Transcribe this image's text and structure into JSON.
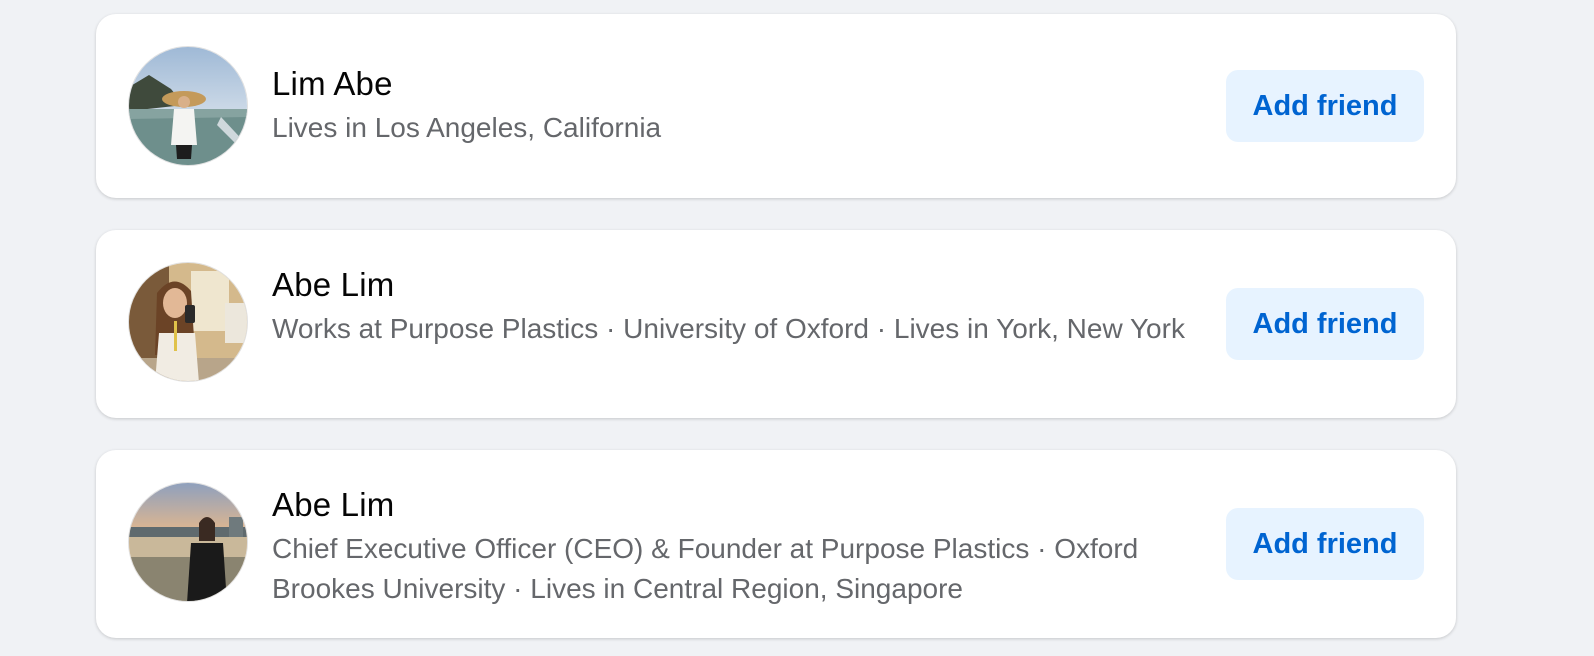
{
  "people": [
    {
      "name": "Lim Abe",
      "details": "Lives in Los Angeles, California",
      "action_label": "Add friend",
      "avatar_icon": "profile-photo"
    },
    {
      "name": "Abe Lim",
      "details": "Works at Purpose Plastics · University of Oxford · Lives in York, New York",
      "action_label": "Add friend",
      "avatar_icon": "profile-photo"
    },
    {
      "name": "Abe Lim",
      "details": "Chief Executive Officer (CEO) & Founder at Purpose Plastics · Oxford Brookes University · Lives in Central Region, Singapore",
      "action_label": "Add friend",
      "avatar_icon": "profile-photo"
    }
  ],
  "colors": {
    "page_background": "#f0f2f5",
    "card_background": "#ffffff",
    "name_text": "#050505",
    "secondary_text": "#65676b",
    "button_background": "#e7f3ff",
    "button_text": "#0064d1"
  }
}
